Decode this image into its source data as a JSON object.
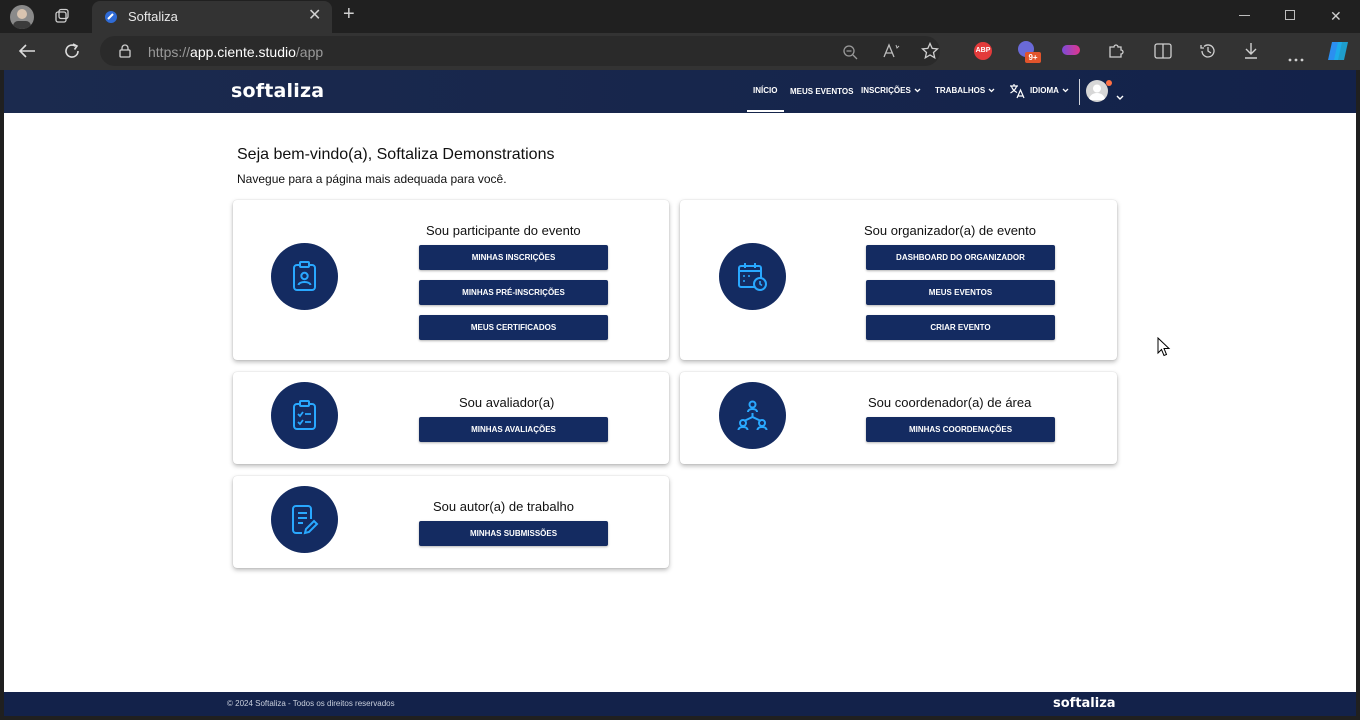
{
  "browser": {
    "tab_title": "Softaliza",
    "new_tab_symbol": "+",
    "close_symbol": "✕",
    "url_prefix": "https://",
    "url_host": "app.ciente.studio",
    "url_path": "/app",
    "abp_badge": "ABP",
    "ext_badge": "9+"
  },
  "app": {
    "brand": "softaliza",
    "nav": {
      "inicio": "INÍCIO",
      "meus_eventos": "MEUS EVENTOS",
      "inscricoes": "INSCRIÇÕES",
      "trabalhos": "TRABALHOS",
      "idioma": "IDIOMA"
    },
    "welcome": "Seja bem-vindo(a), Softaliza Demonstrations",
    "subtitle": "Navegue para a página mais adequada para você.",
    "cards": {
      "participante": {
        "title": "Sou participante do evento",
        "buttons": [
          "MINHAS INSCRIÇÕES",
          "MINHAS PRÉ-INSCRIÇÕES",
          "MEUS CERTIFICADOS"
        ]
      },
      "organizador": {
        "title": "Sou organizador(a) de evento",
        "buttons": [
          "DASHBOARD DO ORGANIZADOR",
          "MEUS EVENTOS",
          "CRIAR EVENTO"
        ]
      },
      "avaliador": {
        "title": "Sou avaliador(a)",
        "buttons": [
          "MINHAS AVALIAÇÕES"
        ]
      },
      "coordenador": {
        "title": "Sou coordenador(a) de área",
        "buttons": [
          "MINHAS COORDENAÇÕES"
        ]
      },
      "autor": {
        "title": "Sou autor(a) de trabalho",
        "buttons": [
          "MINHAS SUBMISSÕES"
        ]
      }
    },
    "footer": {
      "copyright": "© 2024 Softaliza - Todos os direitos reservados",
      "brand": "softaliza"
    }
  },
  "colors": {
    "header_bg": "#13224a",
    "button_bg": "#142b61",
    "icon_accent": "#29a8ff"
  }
}
